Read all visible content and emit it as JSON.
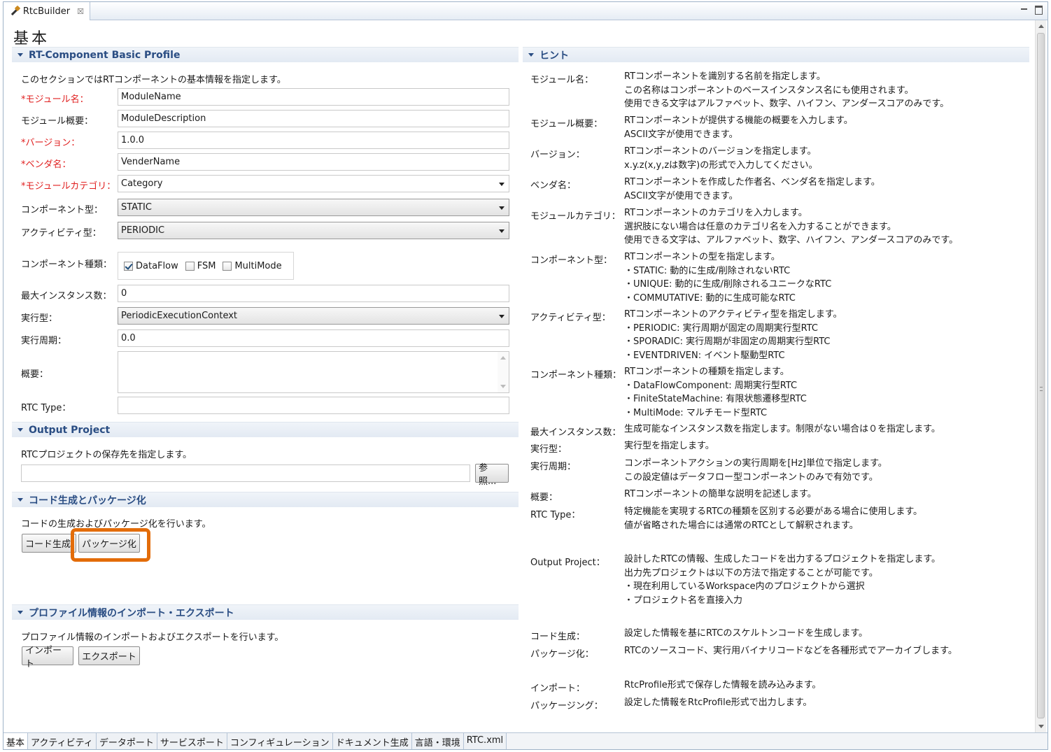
{
  "editor": {
    "tab_label": "RtcBuilder",
    "close_glyph": "☒"
  },
  "page_title": "基本",
  "profile": {
    "header": "RT-Component Basic Profile",
    "desc": "このセクションではRTコンポーネントの基本情報を指定します。",
    "labels": {
      "module_name": "*モジュール名：",
      "module_desc": "モジュール概要：",
      "version": "*バージョン：",
      "vendor": "*ベンダ名：",
      "category": "*モジュールカテゴリ：",
      "comp_type": "コンポーネント型：",
      "activity_type": "アクティビティ型：",
      "comp_kind": "コンポーネント種類：",
      "max_inst": "最大インスタンス数：",
      "exec_type": "実行型：",
      "exec_rate": "実行周期：",
      "abstract": "概要：",
      "rtc_type": "RTC Type："
    },
    "values": {
      "module_name": "ModuleName",
      "module_desc": "ModuleDescription",
      "version": "1.0.0",
      "vendor": "VenderName",
      "category": "Category",
      "comp_type": "STATIC",
      "activity_type": "PERIODIC",
      "max_inst": "0",
      "exec_type": "PeriodicExecutionContext",
      "exec_rate": "0.0",
      "rtc_type": ""
    },
    "kinds": {
      "dataflow": "DataFlow",
      "fsm": "FSM",
      "multimode": "MultiMode"
    }
  },
  "output": {
    "header": "Output Project",
    "desc": "RTCプロジェクトの保存先を指定します。",
    "path": "",
    "browse": "参照..."
  },
  "codegen": {
    "header": "コード生成とパッケージ化",
    "desc": "コードの生成およびパッケージ化を行います。",
    "generate": "コード生成",
    "package": "パッケージ化"
  },
  "profile_io": {
    "header": "プロファイル情報のインポート・エクスポート",
    "desc": "プロファイル情報のインポートおよびエクスポートを行います。",
    "import": "インポート",
    "export": "エクスポート"
  },
  "hints": {
    "header": "ヒント",
    "items": [
      {
        "label": "モジュール名：",
        "text": "RTコンポーネントを識別する名前を指定します。\nこの名称はコンポーネントのベースインスタンス名にも使用されます。\n使用できる文字はアルファベット、数字、ハイフン、アンダースコアのみです。"
      },
      {
        "label": "モジュール概要：",
        "text": "RTコンポーネントが提供する機能の概要を入力します。\nASCII文字が使用できます。"
      },
      {
        "label": "バージョン：",
        "text": "RTコンポーネントのバージョンを指定します。\nx.y.z(x,y,zは数字)の形式で入力してください。"
      },
      {
        "label": "ベンダ名：",
        "text": "RTコンポーネントを作成した作者名、ベンダ名を指定します。\nASCII文字が使用できます。"
      },
      {
        "label": "モジュールカテゴリ：",
        "text": "RTコンポーネントのカテゴリを入力します。\n選択肢にない場合は任意のカテゴリ名を入力することができます。\n使用できる文字は、アルファベット、数字、ハイフン、アンダースコアのみです。"
      },
      {
        "label": "コンポーネント型：",
        "text": "RTコンポーネントの型を指定します。\n・STATIC: 動的に生成/削除されないRTC\n・UNIQUE: 動的に生成/削除されるユニークなRTC\n・COMMUTATIVE: 動的に生成可能なRTC"
      },
      {
        "label": "アクティビティ型：",
        "text": "RTコンポーネントのアクティビティ型を指定します。\n・PERIODIC: 実行周期が固定の周期実行型RTC\n・SPORADIC: 実行周期が非固定の周期実行型RTC\n・EVENTDRIVEN: イベント駆動型RTC"
      },
      {
        "label": "コンポーネント種類：",
        "text": "RTコンポーネントの種類を指定します。\n・DataFlowComponent: 周期実行型RTC\n・FiniteStateMachine: 有限状態遷移型RTC\n・MultiMode: マルチモード型RTC"
      },
      {
        "label": "最大インスタンス数：",
        "text": "生成可能なインスタンス数を指定します。制限がない場合は０を指定します。"
      },
      {
        "label": "実行型：",
        "text": "実行型を指定します。"
      },
      {
        "label": "実行周期：",
        "text": "コンポーネントアクションの実行周期を[Hz]単位で指定します。\nこの設定値はデータフロー型コンポーネントのみで有効です。"
      },
      {
        "label": "概要：",
        "text": "RTコンポーネントの簡単な説明を記述します。"
      },
      {
        "label": "RTC Type：",
        "text": "特定機能を実現するRTCの種類を区別する必要がある場合に使用します。\n値が省略された場合には通常のRTCとして解釈されます。"
      },
      {
        "label": "Output Project：",
        "text": "設計したRTCの情報、生成したコードを出力するプロジェクトを指定します。\n出力先プロジェクトは以下の方法で指定することが可能です。\n・現在利用しているWorkspace内のプロジェクトから選択\n・プロジェクト名を直接入力"
      },
      {
        "label": "コード生成：",
        "text": "設定した情報を基にRTCのスケルトンコードを生成します。"
      },
      {
        "label": "パッケージ化：",
        "text": "RTCのソースコード、実行用バイナリコードなどを各種形式でアーカイブします。"
      },
      {
        "label": "インポート：",
        "text": "RtcProfile形式で保存した情報を読み込みます。"
      },
      {
        "label": "パッケージング：",
        "text": "設定した情報をRtcProfile形式で出力します。"
      }
    ]
  },
  "bottom_tabs": [
    "基本",
    "アクティビティ",
    "データポート",
    "サービスポート",
    "コンフィギュレーション",
    "ドキュメント生成",
    "言語・環境",
    "RTC.xml"
  ],
  "colors": {
    "required": "#e02020",
    "section_title": "#2a4d83",
    "highlight": "#e36c09"
  }
}
